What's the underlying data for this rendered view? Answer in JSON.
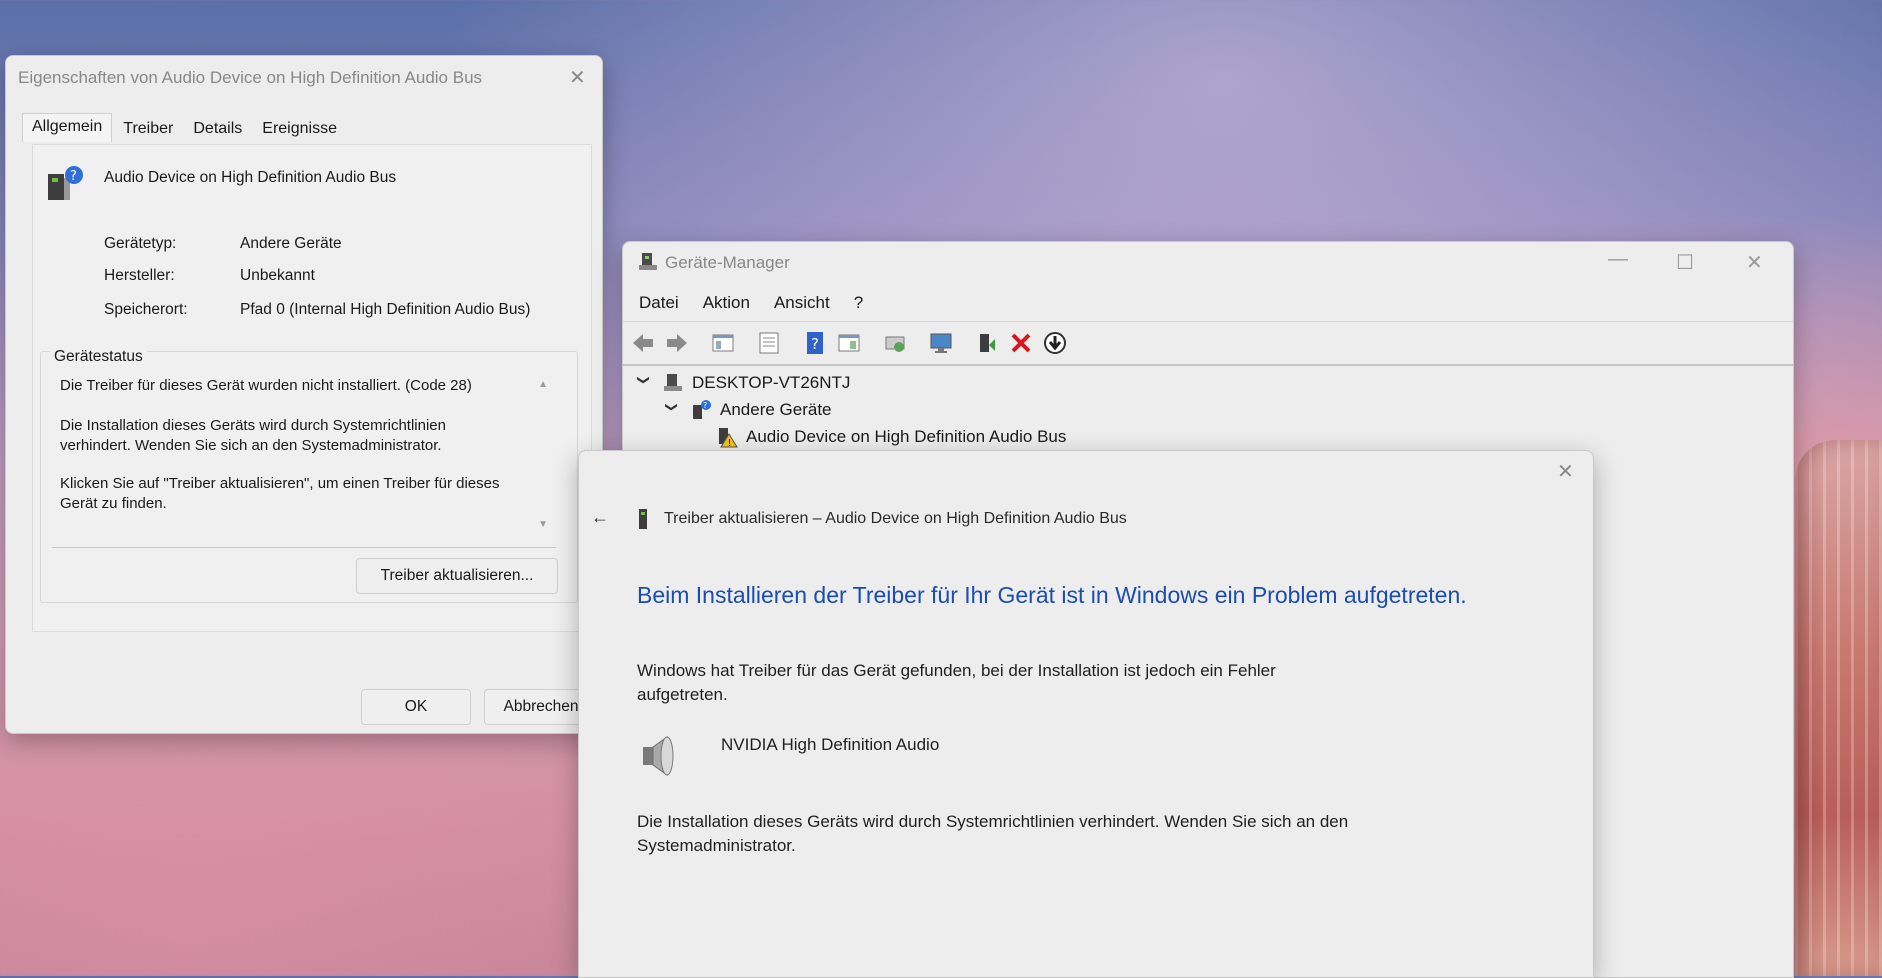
{
  "props_dialog": {
    "title": "Eigenschaften von Audio Device on High Definition Audio Bus",
    "tabs": [
      "Allgemein",
      "Treiber",
      "Details",
      "Ereignisse"
    ],
    "device_name": "Audio Device on High Definition Audio Bus",
    "fields": [
      {
        "label": "Gerätetyp:",
        "value": "Andere Geräte"
      },
      {
        "label": "Hersteller:",
        "value": "Unbekannt"
      },
      {
        "label": "Speicherort:",
        "value": "Pfad 0 (Internal High Definition Audio Bus)"
      }
    ],
    "status_label": "Gerätestatus",
    "status_lines": [
      "Die Treiber für dieses Gerät wurden nicht installiert. (Code 28)",
      "Die Installation dieses Geräts wird durch Systemrichtlinien\nverhindert. Wenden Sie sich an den Systemadministrator.",
      "Klicken Sie auf \"Treiber aktualisieren\", um einen Treiber für dieses\nGerät zu finden."
    ],
    "update_button": "Treiber aktualisieren...",
    "ok_button": "OK",
    "cancel_button": "Abbrechen"
  },
  "device_manager": {
    "title": "Geräte-Manager",
    "menu": [
      "Datei",
      "Aktion",
      "Ansicht",
      "?"
    ],
    "tree": {
      "computer": "DESKTOP-VT26NTJ",
      "category": "Andere Geräte",
      "device": "Audio Device on High Definition Audio Bus"
    }
  },
  "update_dialog": {
    "title": "Treiber aktualisieren – Audio Device on High Definition Audio Bus",
    "heading": "Beim Installieren der Treiber für Ihr Gerät ist in Windows ein Problem aufgetreten.",
    "found_text": "Windows hat Treiber für das Gerät gefunden, bei der Installation ist jedoch ein Fehler\naufgetreten.",
    "driver_name": "NVIDIA High Definition Audio",
    "policy_text": "Die Installation dieses Geräts wird durch Systemrichtlinien verhindert. Wenden Sie sich an den\nSystemadministrator."
  },
  "colors": {
    "heading_blue": "#1b4db0",
    "error_red": "#d6181e",
    "dialog_bg": "#ededed"
  }
}
